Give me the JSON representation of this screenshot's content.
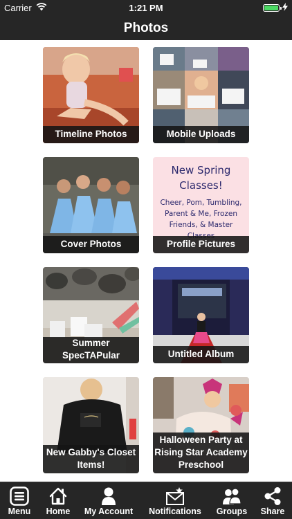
{
  "status_bar": {
    "carrier": "Carrier",
    "time": "1:21 PM",
    "battery_level": 1.0
  },
  "header": {
    "title": "Photos"
  },
  "albums": [
    {
      "title": "Timeline Photos"
    },
    {
      "title": "Mobile Uploads"
    },
    {
      "title": "Cover Photos"
    },
    {
      "title": "Profile Pictures",
      "thumb_text": {
        "title": "New Spring Classes!",
        "subtitle": "Cheer, Pom, Tumbling, Parent & Me, Frozen Friends, & Master Classes"
      }
    },
    {
      "title": "Summer SpecTAPular"
    },
    {
      "title": "Untitled Album"
    },
    {
      "title": "New Gabby's Closet Items!"
    },
    {
      "title": "Halloween Party at Rising Star Academy Preschool"
    }
  ],
  "tabs": [
    {
      "label": "Menu",
      "icon": "menu-icon"
    },
    {
      "label": "Home",
      "icon": "home-icon"
    },
    {
      "label": "My Account",
      "icon": "user-icon"
    },
    {
      "label": "Notifications",
      "icon": "envelope-star-icon"
    },
    {
      "label": "Groups",
      "icon": "group-icon"
    },
    {
      "label": "Share",
      "icon": "share-icon"
    }
  ],
  "colors": {
    "bar_background": "#262626",
    "battery": "#4cd964",
    "caption_background": "#141414"
  }
}
